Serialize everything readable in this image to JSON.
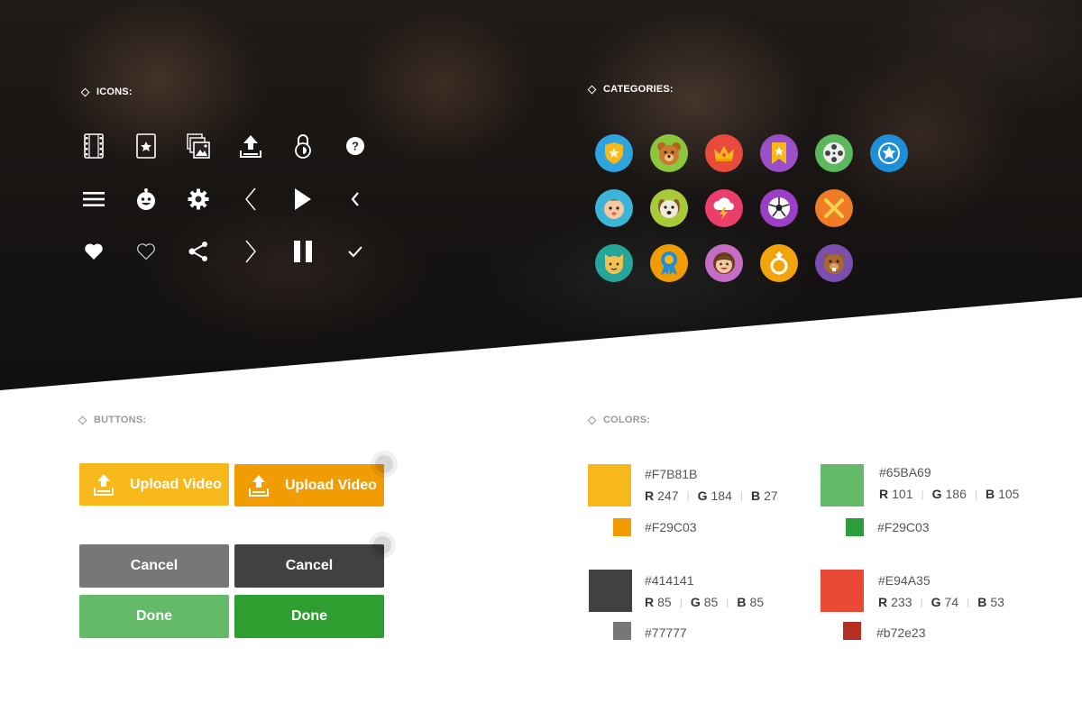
{
  "sections": {
    "icons": "ICONS:",
    "categories": "CATEGORIES:",
    "buttons": "BUTTONS:",
    "colors": "COLORS:"
  },
  "icons": [
    [
      "film-icon",
      "star-card-icon",
      "gallery-icon",
      "upload-icon",
      "lock-icon",
      "help-icon"
    ],
    [
      "menu-icon",
      "mascot-icon",
      "gear-icon",
      "chevron-left-thin-icon",
      "play-icon",
      "chevron-left-icon"
    ],
    [
      "heart-filled-icon",
      "heart-outline-icon",
      "share-icon",
      "chevron-right-thin-icon",
      "pause-icon",
      "check-icon"
    ]
  ],
  "categories": [
    [
      {
        "icon": "shield-star-icon",
        "color": "#2ea3dd"
      },
      {
        "icon": "bear-icon",
        "color": "#8cc63f"
      },
      {
        "icon": "crown-icon",
        "color": "#e84a3c"
      },
      {
        "icon": "bookmark-star-icon",
        "color": "#9b4fc7"
      },
      {
        "icon": "film-reel-icon",
        "color": "#5cb85c"
      },
      {
        "icon": "star-badge-icon",
        "color": "#1e8fd6"
      }
    ],
    [
      {
        "icon": "baby-icon",
        "color": "#3bb4d8"
      },
      {
        "icon": "dog-icon",
        "color": "#a7c93a"
      },
      {
        "icon": "storm-cloud-icon",
        "color": "#ea3f6b"
      },
      {
        "icon": "soccer-ball-icon",
        "color": "#9b3fc7"
      },
      {
        "icon": "close-x-icon",
        "color": "#f07c27"
      }
    ],
    [
      {
        "icon": "cat-icon",
        "color": "#26a69a"
      },
      {
        "icon": "ribbon-medal-icon",
        "color": "#f29c03"
      },
      {
        "icon": "girl-icon",
        "color": "#c56cc5"
      },
      {
        "icon": "ring-icon",
        "color": "#f2a40c"
      },
      {
        "icon": "beaver-icon",
        "color": "#7b4fb0"
      }
    ]
  ],
  "buttons": {
    "upload_label": "Upload Video",
    "cancel_label": "Cancel",
    "done_label": "Done"
  },
  "colors": {
    "yellow": {
      "hex": "#F7B81B",
      "r": "247",
      "g": "184",
      "b": "27",
      "alt": "#F29C03"
    },
    "green": {
      "hex": "#65BA69",
      "r": "101",
      "g": "186",
      "b": "105",
      "alt": "#F29C03",
      "alt_swatch": "#2e9e3c"
    },
    "dark": {
      "hex": "#414141",
      "r": "85",
      "g": "85",
      "b": "85",
      "alt": "#77777",
      "alt_swatch": "#777777"
    },
    "red": {
      "hex": "#E94A35",
      "r": "233",
      "g": "74",
      "b": "53",
      "alt": "#b72e23"
    }
  },
  "rgb_labels": {
    "r": "R",
    "g": "G",
    "b": "B"
  }
}
